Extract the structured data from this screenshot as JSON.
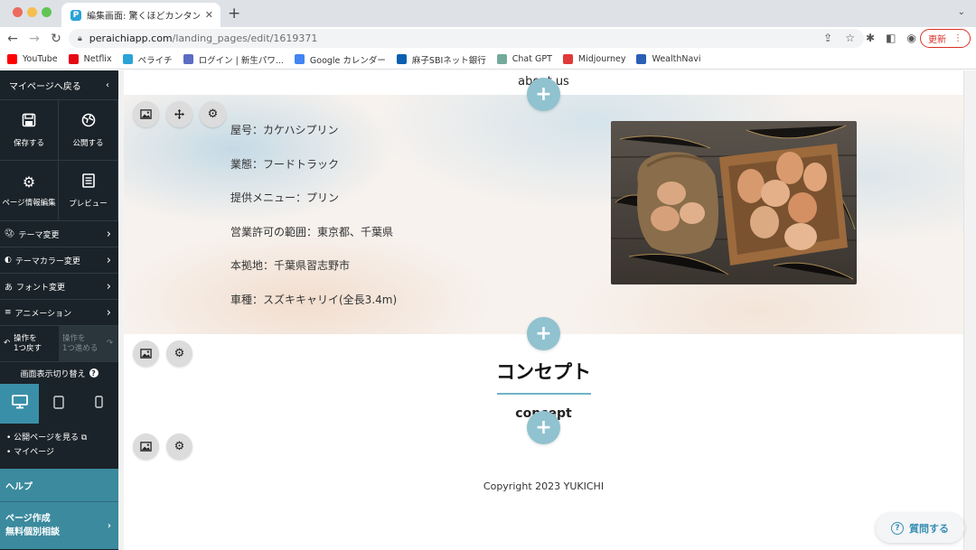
{
  "browser": {
    "tab_title": "編集画面: 驚くほどカンタン！無料",
    "url_host": "peraichiapp.com",
    "url_path": "/landing_pages/edit/1619371",
    "update_label": "更新",
    "bookmarks": [
      {
        "label": "YouTube",
        "icon": "youtube-icon",
        "color": "#ff0000"
      },
      {
        "label": "Netflix",
        "icon": "netflix-icon",
        "color": "#e50914"
      },
      {
        "label": "ペライチ",
        "icon": "peraichi-icon",
        "color": "#2aa3d8"
      },
      {
        "label": "ログイン | 新生パワ...",
        "icon": "shinsei-icon",
        "color": "#5b6cc2"
      },
      {
        "label": "Google カレンダー",
        "icon": "calendar-icon",
        "color": "#4285f4"
      },
      {
        "label": "麻子SBIネット銀行",
        "icon": "sbi-icon",
        "color": "#0b5fb0"
      },
      {
        "label": "Chat GPT",
        "icon": "chatgpt-icon",
        "color": "#74aa9c"
      },
      {
        "label": "Midjourney",
        "icon": "midjourney-icon",
        "color": "#e03a3a"
      },
      {
        "label": "WealthNavi",
        "icon": "wealthnavi-icon",
        "color": "#2a5fb6"
      }
    ]
  },
  "sidebar": {
    "back_label": "マイページへ戻る",
    "save_label": "保存する",
    "publish_label": "公開する",
    "page_info_label": "ページ情報編集",
    "preview_label": "プレビュー",
    "menu": [
      {
        "label": "テーマ変更",
        "icon": "theme-icon"
      },
      {
        "label": "テーマカラー変更",
        "icon": "palette-icon"
      },
      {
        "label": "フォント変更",
        "icon": "font-icon"
      },
      {
        "label": "アニメーション",
        "icon": "animation-icon"
      }
    ],
    "undo_label_1": "操作を",
    "undo_label_2": "1つ戻す",
    "redo_label_1": "操作を",
    "redo_label_2": "1つ進める",
    "view_switch_label": "画面表示切り替え",
    "links": [
      "公開ページを見る",
      "マイページ"
    ],
    "help_label": "ヘルプ",
    "consult_label_1": "ページ作成",
    "consult_label_2": "無料個別相談"
  },
  "canvas": {
    "about_heading_en": "about us",
    "info_items": [
      "屋号：カケハシプリン",
      "業態：フードトラック",
      "提供メニュー：プリン",
      "営業許可の範囲：東京都、千葉県",
      "本拠地：千葉県習志野市",
      "車種：スズキキャリイ(全長3.4m)"
    ],
    "concept_heading_ja": "コンセプト",
    "concept_heading_en": "concept",
    "copyright": "Copyright 2023 YUKICHI"
  },
  "question_button_label": "質問する"
}
